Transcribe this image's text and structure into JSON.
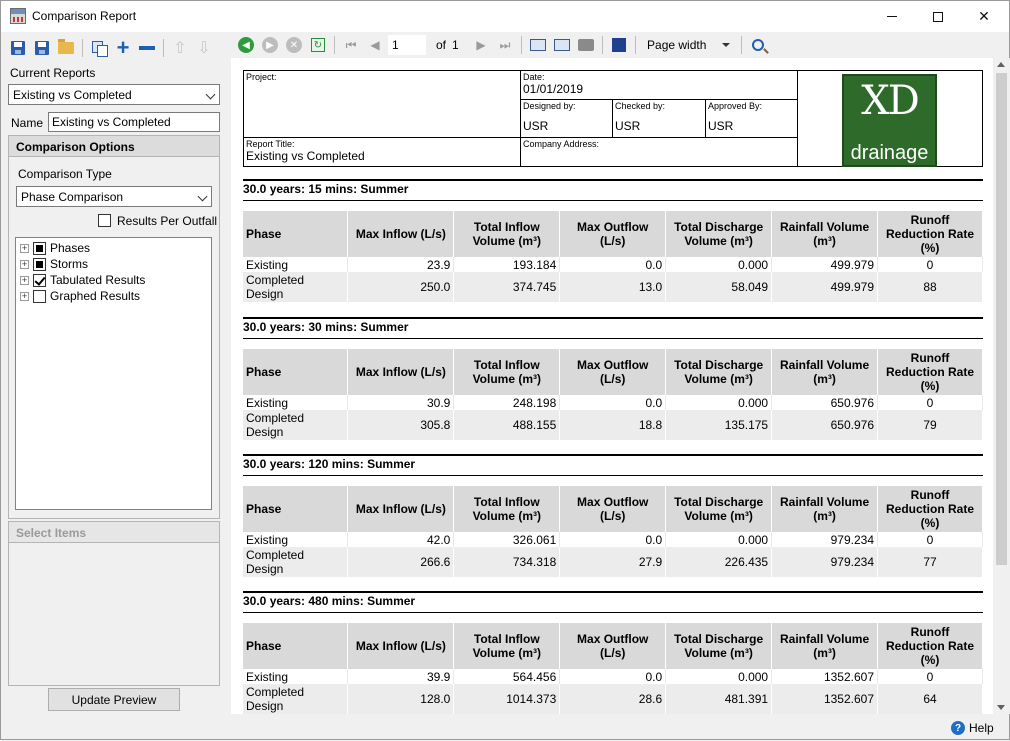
{
  "window": {
    "title": "Comparison Report",
    "controls": {
      "minimize": "minimize-icon",
      "maximize": "maximize-icon",
      "close": "close-icon",
      "close_glyph": "✕"
    }
  },
  "left_toolbar": {
    "icons": [
      "save-icon",
      "save-as-icon",
      "open-folder-icon",
      "copy-icon",
      "add-icon",
      "remove-icon",
      "move-up-icon",
      "move-down-icon"
    ]
  },
  "current_reports": {
    "label": "Current Reports",
    "selected": "Existing vs Completed"
  },
  "name_field": {
    "label": "Name",
    "value": "Existing vs Completed"
  },
  "comparison_options": {
    "header": "Comparison Options",
    "type_label": "Comparison Type",
    "type_selected": "Phase Comparison",
    "results_per_outfall_label": "Results Per Outfall",
    "results_per_outfall_checked": false,
    "tree": [
      {
        "label": "Phases",
        "state": "partial",
        "expander": "+"
      },
      {
        "label": "Storms",
        "state": "partial",
        "expander": "+"
      },
      {
        "label": "Tabulated Results",
        "state": "checked",
        "expander": "+"
      },
      {
        "label": "Graphed Results",
        "state": "unchecked",
        "expander": "+"
      }
    ]
  },
  "select_items": {
    "header": "Select Items"
  },
  "update_button": "Update Preview",
  "right_toolbar": {
    "page_current": "1",
    "of_label": "of",
    "page_total": "1",
    "zoom": "Page width",
    "icons": [
      "back-icon",
      "forward-icon",
      "stop-icon",
      "refresh-icon",
      "first-page-icon",
      "prev-page-icon",
      "next-page-icon",
      "last-page-icon",
      "book-icon",
      "page-setup-icon",
      "print-icon",
      "export-icon",
      "zoom-icon"
    ]
  },
  "report_header": {
    "project_label": "Project:",
    "project_value": "",
    "date_label": "Date:",
    "date_value": "01/01/2019",
    "designed_label": "Designed by:",
    "designed_value": "USR",
    "checked_label": "Checked by:",
    "checked_value": "USR",
    "approved_label": "Approved By:",
    "approved_value": "USR",
    "report_title_label": "Report Title:",
    "report_title_value": "Existing vs Completed",
    "company_label": "Company Address:",
    "company_value": "",
    "logo": {
      "mark": "XD",
      "word": "drainage",
      "color": "#2e6b2a"
    }
  },
  "columns": {
    "phase": "Phase",
    "max_inflow": "Max Inflow (L/s)",
    "total_inflow": "Total Inflow Volume (m³)",
    "max_outflow": "Max Outflow (L/s)",
    "total_discharge": "Total Discharge Volume (m³)",
    "rainfall_volume": "Rainfall Volume (m³)",
    "runoff_reduction": "Runoff Reduction Rate (%)"
  },
  "sections": [
    {
      "title": "30.0 years: 15 mins: Summer",
      "rows": [
        {
          "phase": "Existing",
          "max_inflow": "23.9",
          "total_inflow": "193.184",
          "max_outflow": "0.0",
          "total_discharge": "0.000",
          "rainfall": "499.979",
          "runoff": "0"
        },
        {
          "phase": "Completed Design",
          "max_inflow": "250.0",
          "total_inflow": "374.745",
          "max_outflow": "13.0",
          "total_discharge": "58.049",
          "rainfall": "499.979",
          "runoff": "88"
        }
      ]
    },
    {
      "title": "30.0 years: 30 mins: Summer",
      "rows": [
        {
          "phase": "Existing",
          "max_inflow": "30.9",
          "total_inflow": "248.198",
          "max_outflow": "0.0",
          "total_discharge": "0.000",
          "rainfall": "650.976",
          "runoff": "0"
        },
        {
          "phase": "Completed Design",
          "max_inflow": "305.8",
          "total_inflow": "488.155",
          "max_outflow": "18.8",
          "total_discharge": "135.175",
          "rainfall": "650.976",
          "runoff": "79"
        }
      ]
    },
    {
      "title": "30.0 years: 120 mins: Summer",
      "rows": [
        {
          "phase": "Existing",
          "max_inflow": "42.0",
          "total_inflow": "326.061",
          "max_outflow": "0.0",
          "total_discharge": "0.000",
          "rainfall": "979.234",
          "runoff": "0"
        },
        {
          "phase": "Completed Design",
          "max_inflow": "266.6",
          "total_inflow": "734.318",
          "max_outflow": "27.9",
          "total_discharge": "226.435",
          "rainfall": "979.234",
          "runoff": "77"
        }
      ]
    },
    {
      "title": "30.0 years: 480 mins: Summer",
      "rows": [
        {
          "phase": "Existing",
          "max_inflow": "39.9",
          "total_inflow": "564.456",
          "max_outflow": "0.0",
          "total_discharge": "0.000",
          "rainfall": "1352.607",
          "runoff": "0"
        },
        {
          "phase": "Completed Design",
          "max_inflow": "128.0",
          "total_inflow": "1014.373",
          "max_outflow": "28.6",
          "total_discharge": "481.391",
          "rainfall": "1352.607",
          "runoff": "64"
        }
      ]
    }
  ],
  "help": {
    "label": "Help",
    "glyph": "?"
  }
}
